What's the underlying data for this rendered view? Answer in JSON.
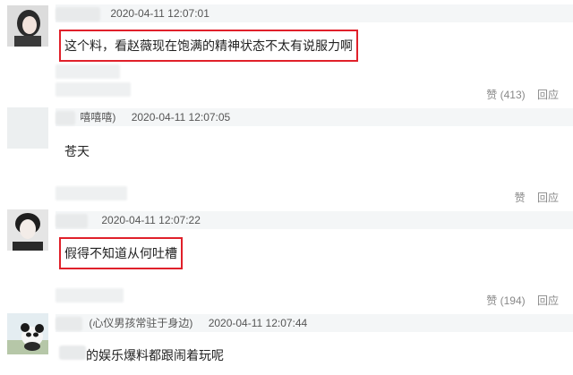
{
  "comments": [
    {
      "nick": "",
      "time": "2020-04-11 12:07:01",
      "text": "这个料，看赵薇现在饱满的精神状态不太有说服力啊",
      "like_label": "赞",
      "like_count": "(413)",
      "reply_label": "回应"
    },
    {
      "nick": "嘻嘻嘻)",
      "time": "2020-04-11 12:07:05",
      "text": "苍天",
      "like_label": "赞",
      "like_count": "",
      "reply_label": "回应"
    },
    {
      "nick": "",
      "time": "2020-04-11 12:07:22",
      "text": "假得不知道从何吐槽",
      "like_label": "赞",
      "like_count": "(194)",
      "reply_label": "回应"
    },
    {
      "nick": "(心仪男孩常驻于身边)",
      "time": "2020-04-11 12:07:44",
      "text": "的娱乐爆料都跟闹着玩呢",
      "like_label": "",
      "like_count": "",
      "reply_label": ""
    }
  ],
  "colors": {
    "highlight_border": "#e0202a",
    "meta_bg": "#f4f6f7"
  }
}
